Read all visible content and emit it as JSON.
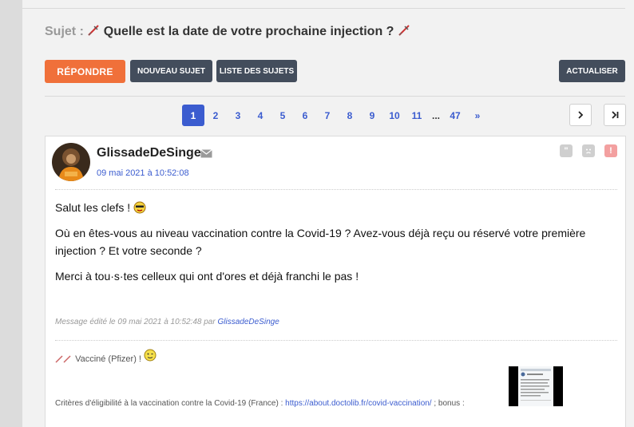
{
  "subject": {
    "label": "Sujet :",
    "title": "Quelle est la date de votre prochaine injection ?"
  },
  "toolbar": {
    "reply_label": "RÉPONDRE",
    "new_topic_label": "NOUVEAU SUJET",
    "topic_list_label": "LISTE DES SUJETS",
    "refresh_label": "ACTUALISER"
  },
  "pagination": {
    "pages": [
      "1",
      "2",
      "3",
      "4",
      "5",
      "6",
      "7",
      "8",
      "9",
      "10",
      "11"
    ],
    "current": "1",
    "ellipsis": "...",
    "last": "47",
    "next_more": "»"
  },
  "post": {
    "author": "GlissadeDeSinge",
    "date": "09 mai 2021 à 10:52:08",
    "paragraph1": "Salut les clefs !",
    "paragraph2": "Où en êtes-vous au niveau vaccination contre la Covid-19 ? Avez-vous déjà reçu ou réservé votre première injection ? Et votre seconde ?",
    "paragraph3": "Merci à tou·s·tes celleux qui ont d'ores et déjà franchi le pas !",
    "edited_prefix": "Message édité le 09 mai 2021 à 10:52:48 par",
    "edited_by": "GlissadeDeSinge",
    "signature_line1": "Vacciné (Pfizer) !",
    "signature_line2_prefix": "Critères d'éligibilité à la vaccination contre la Covid-19 (France) :",
    "signature_link": "https://about.doctolib.fr/covid-vaccination/",
    "signature_line2_suffix": "; bonus :"
  },
  "icons": {
    "quote": "quote-icon",
    "mp": "mail-icon",
    "blacklist": "sad-face-icon",
    "report": "alert-icon"
  },
  "colors": {
    "accent_orange": "#f0703a",
    "dark_button": "#434d5c",
    "link_blue": "#3b5ccf"
  }
}
